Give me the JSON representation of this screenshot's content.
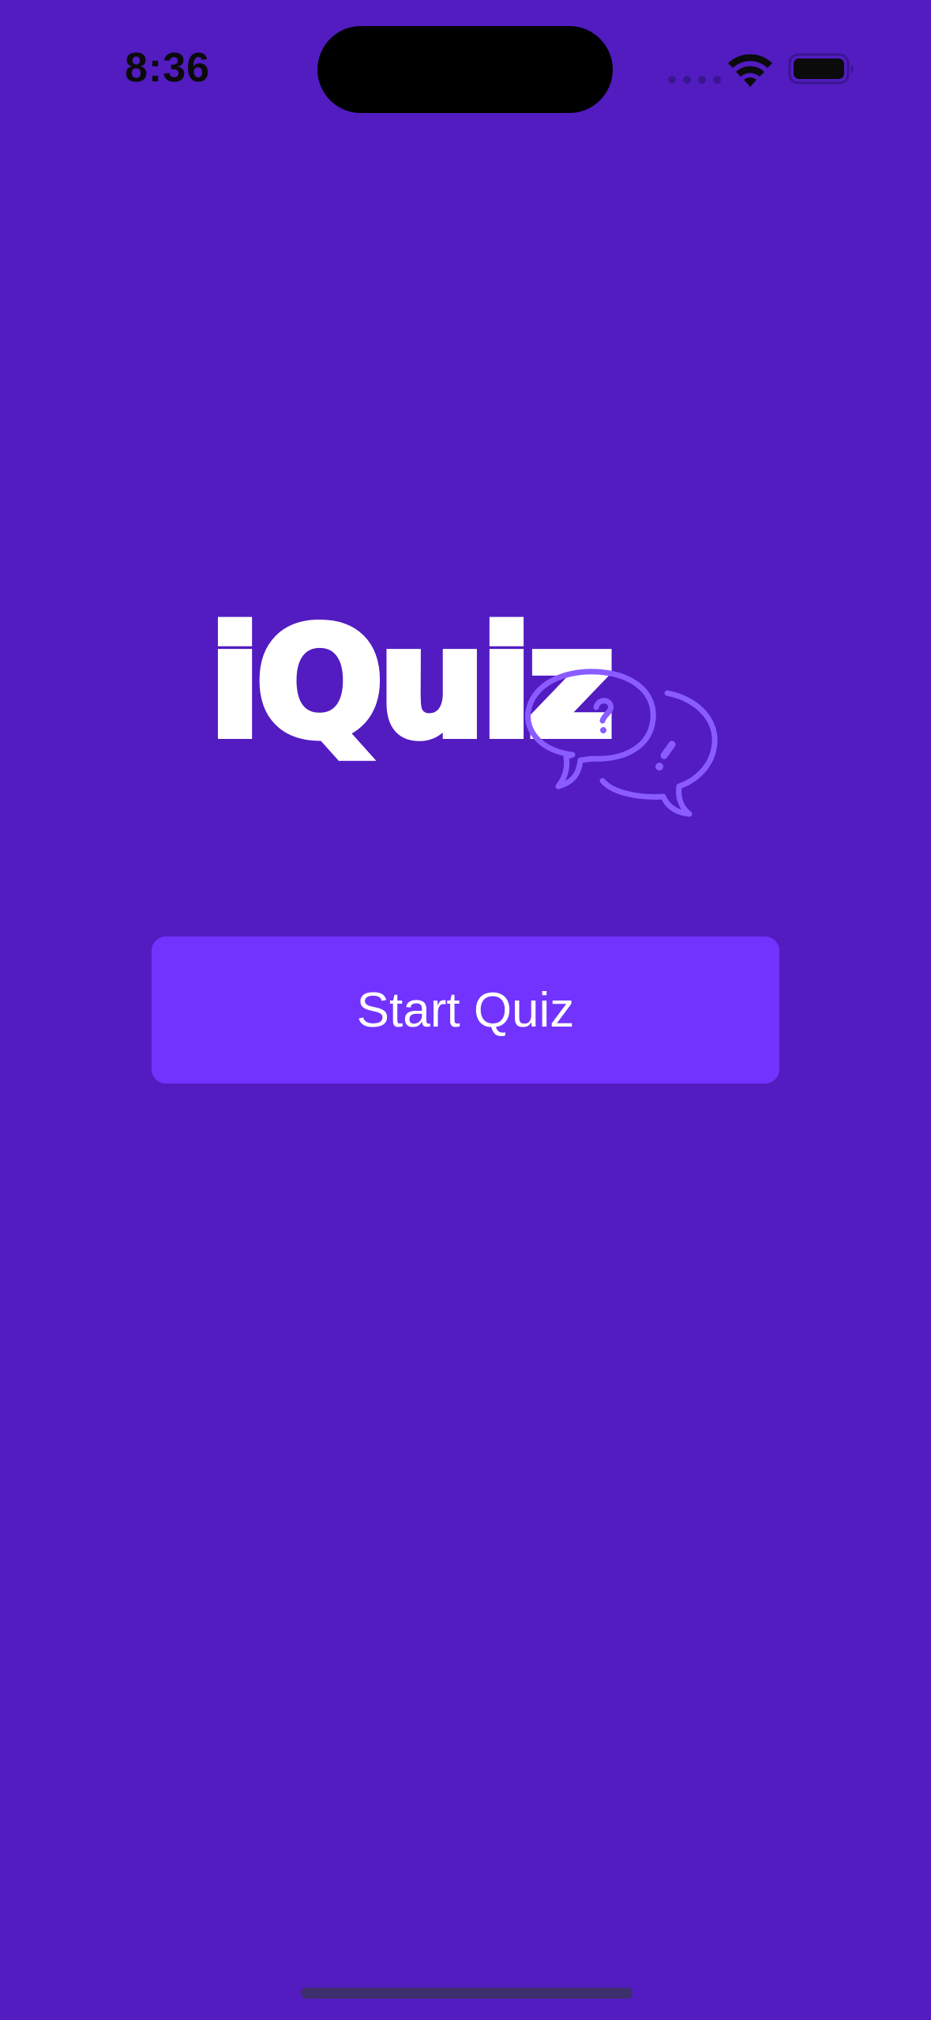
{
  "status_bar": {
    "time": "8:36",
    "icons": [
      "signal-dots-icon",
      "wifi-icon",
      "battery-icon"
    ]
  },
  "logo": {
    "text": "iQuiz",
    "decoration_icon": "speech-bubbles-question-exclamation-icon"
  },
  "main": {
    "start_button_label": "Start Quiz"
  },
  "colors": {
    "background": "#521cc1",
    "button": "#7233ff",
    "bubble_outline": "#8a5cff",
    "text": "#ffffff"
  }
}
